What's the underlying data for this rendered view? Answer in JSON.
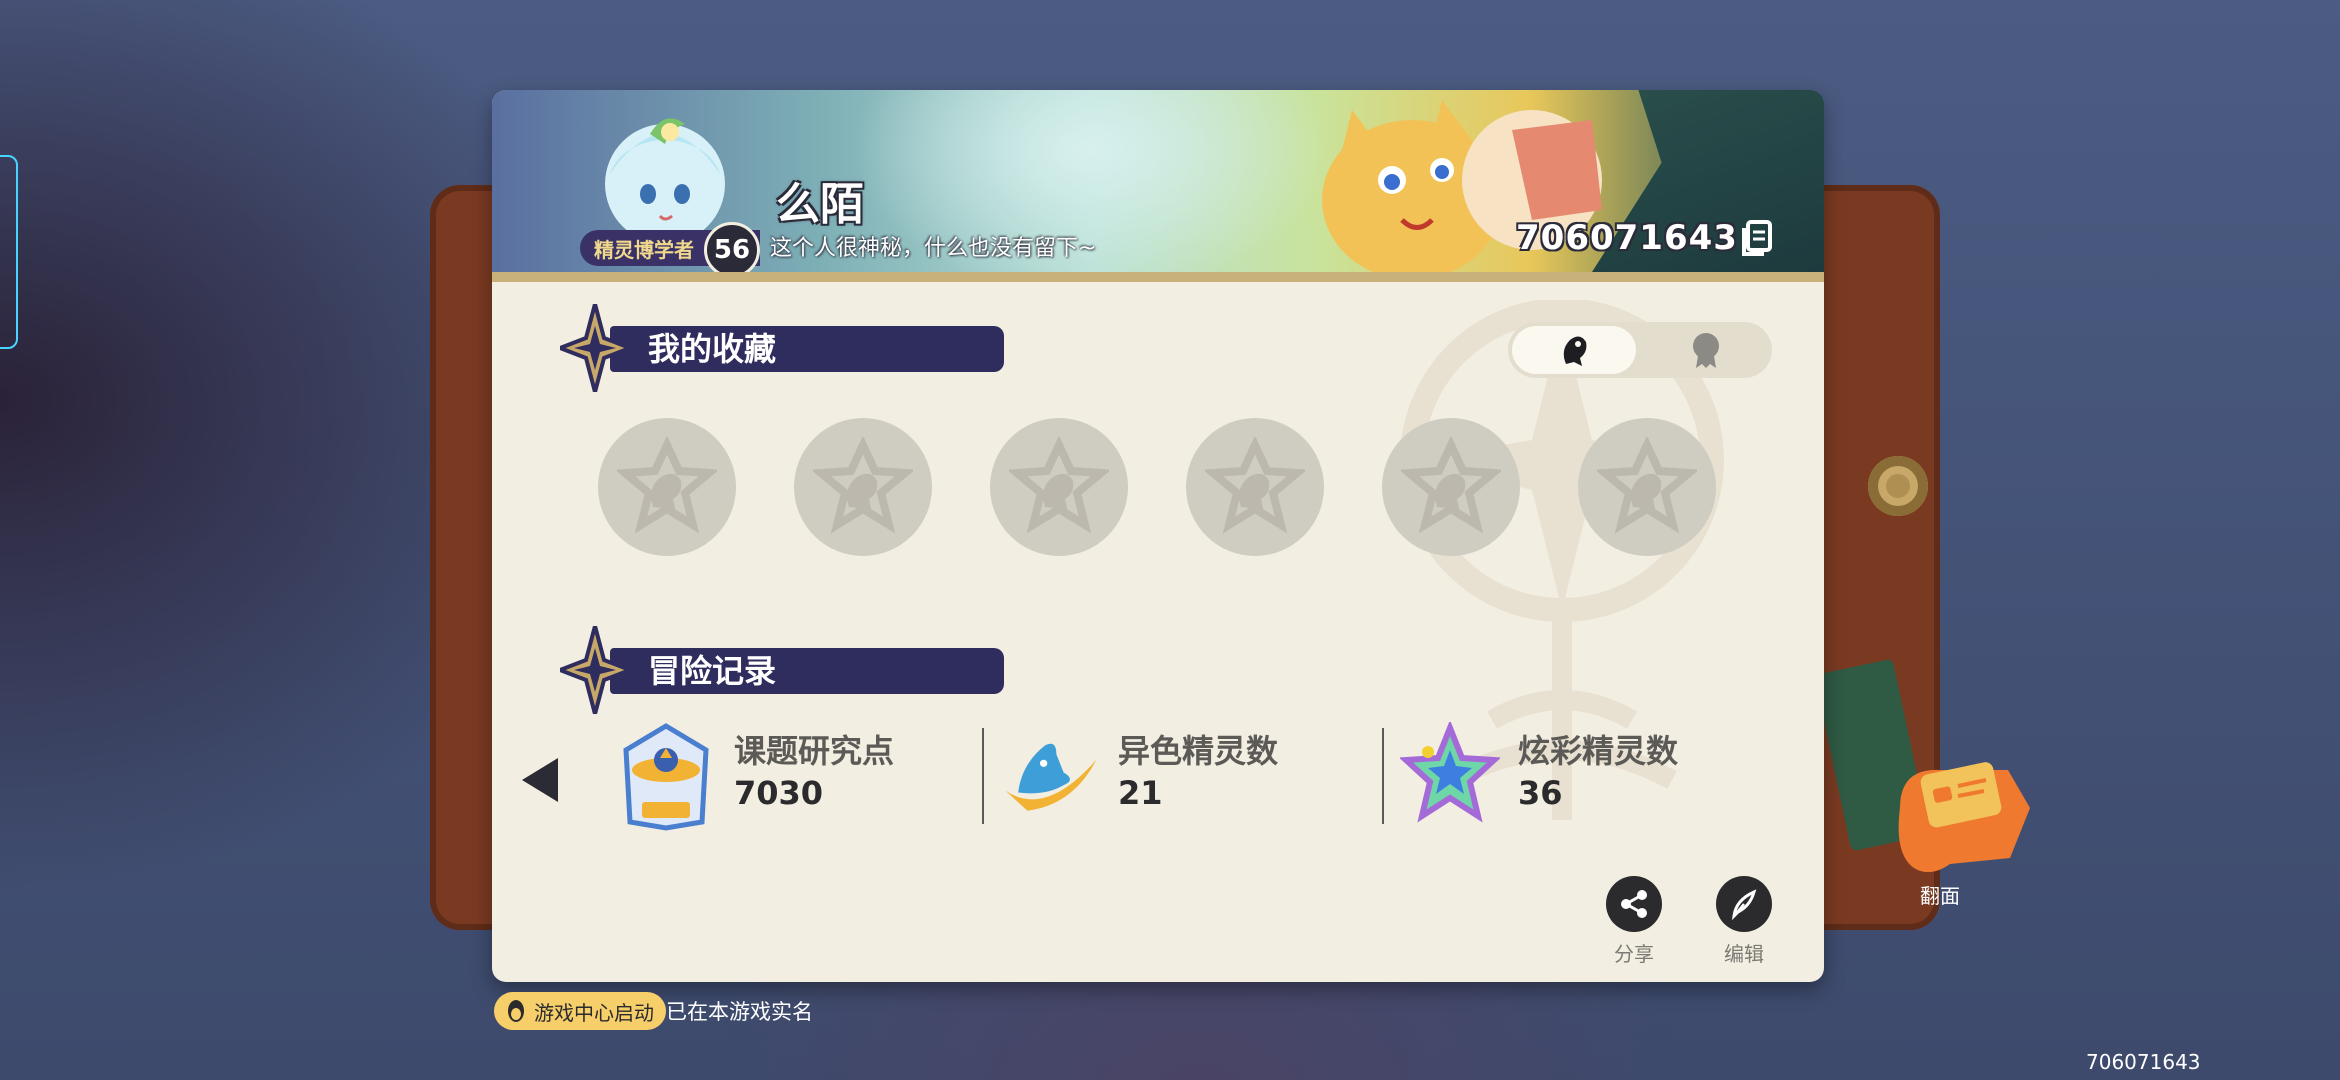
{
  "profile": {
    "name": "么陌",
    "title_badge": "精灵博学者",
    "level": "56",
    "signature": "这个人很神秘，什么也没有留下~",
    "uid": "706071643"
  },
  "collection": {
    "title": "我的收藏",
    "slot_count": 6
  },
  "adventure": {
    "title": "冒险记录",
    "stats": [
      {
        "label": "课题研究点",
        "value": "7030",
        "icon": "research-badge-icon"
      },
      {
        "label": "异色精灵数",
        "value": "21",
        "icon": "shiny-spirit-icon"
      },
      {
        "label": "炫彩精灵数",
        "value": "36",
        "icon": "rainbow-star-icon"
      }
    ]
  },
  "actions": {
    "share_label": "分享",
    "edit_label": "编辑",
    "flip_label": "翻面"
  },
  "footer": {
    "game_center_label": "游戏中心启动",
    "realname_text": "已在本游戏实名",
    "uid": "706071643"
  },
  "colors": {
    "card_bg": "#f3eee2",
    "section_bar": "#2f2c5e",
    "accent_gold": "#c8a868",
    "badge_yellow": "#f7cf6a"
  }
}
